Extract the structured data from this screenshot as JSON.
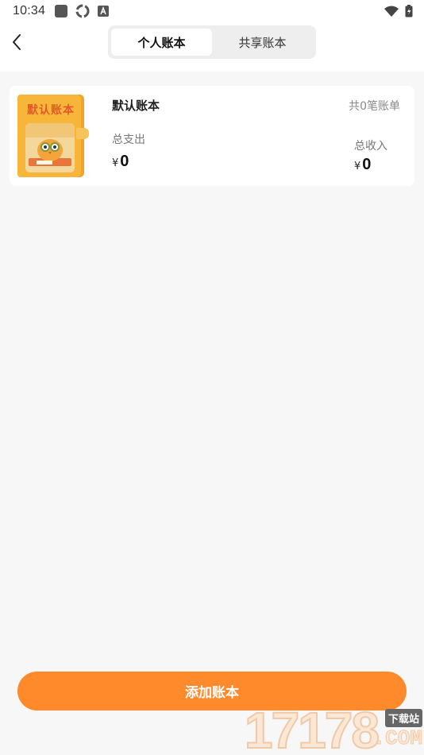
{
  "status_bar": {
    "time": "10:34"
  },
  "header": {
    "tabs": [
      {
        "label": "个人账本",
        "active": true
      },
      {
        "label": "共享账本",
        "active": false
      }
    ]
  },
  "ledger": {
    "book_cover_text": "默认账本",
    "name": "默认账本",
    "count_text": "共0笔账单",
    "expense_label": "总支出",
    "expense_currency": "¥",
    "expense_value": "0",
    "income_label": "总收入",
    "income_currency": "¥",
    "income_value": "0"
  },
  "add_button": {
    "label": "添加账本"
  },
  "watermark": {
    "digits": "17178",
    "site_label": "下载站",
    "domain": ".COM"
  },
  "colors": {
    "accent": "#fe8a2c",
    "book": "#f7b63a",
    "book_title": "#e25a2a"
  },
  "icons": [
    "back-arrow-icon",
    "app-notification-icon",
    "sync-icon",
    "a-icon",
    "wifi-icon",
    "battery-icon"
  ]
}
